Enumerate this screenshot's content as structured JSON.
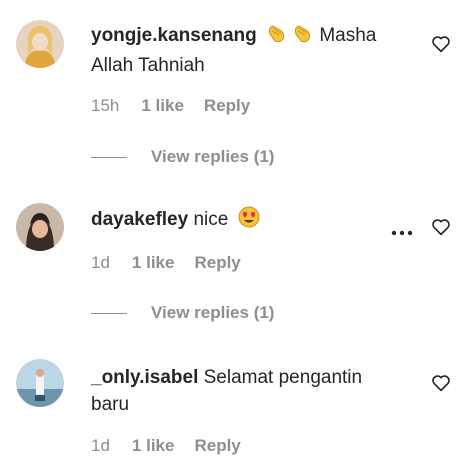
{
  "comments": [
    {
      "username": "yongje.kansenang",
      "text": " Masha Allah Tahniah",
      "emoji": [
        "clapping-hands",
        "clapping-hands"
      ],
      "time": "15h",
      "likes": "1 like",
      "reply": "Reply",
      "view_replies": "View replies (1)"
    },
    {
      "username": "dayakefley",
      "text": " nice ",
      "emoji": [
        "heart-eyes-face"
      ],
      "time": "1d",
      "likes": "1 like",
      "reply": "Reply",
      "view_replies": "View replies (1)",
      "more_icon": "more-options"
    },
    {
      "username": "_only.isabel",
      "text": " Selamat pengantin baru",
      "time": "1d",
      "likes": "1 like",
      "reply": "Reply"
    }
  ],
  "colors": {
    "text": "#262626",
    "secondary": "#8e8e8e",
    "background": "#ffffff"
  },
  "icons": {
    "like": "heart-outline-icon",
    "more": "ellipsis-icon"
  }
}
